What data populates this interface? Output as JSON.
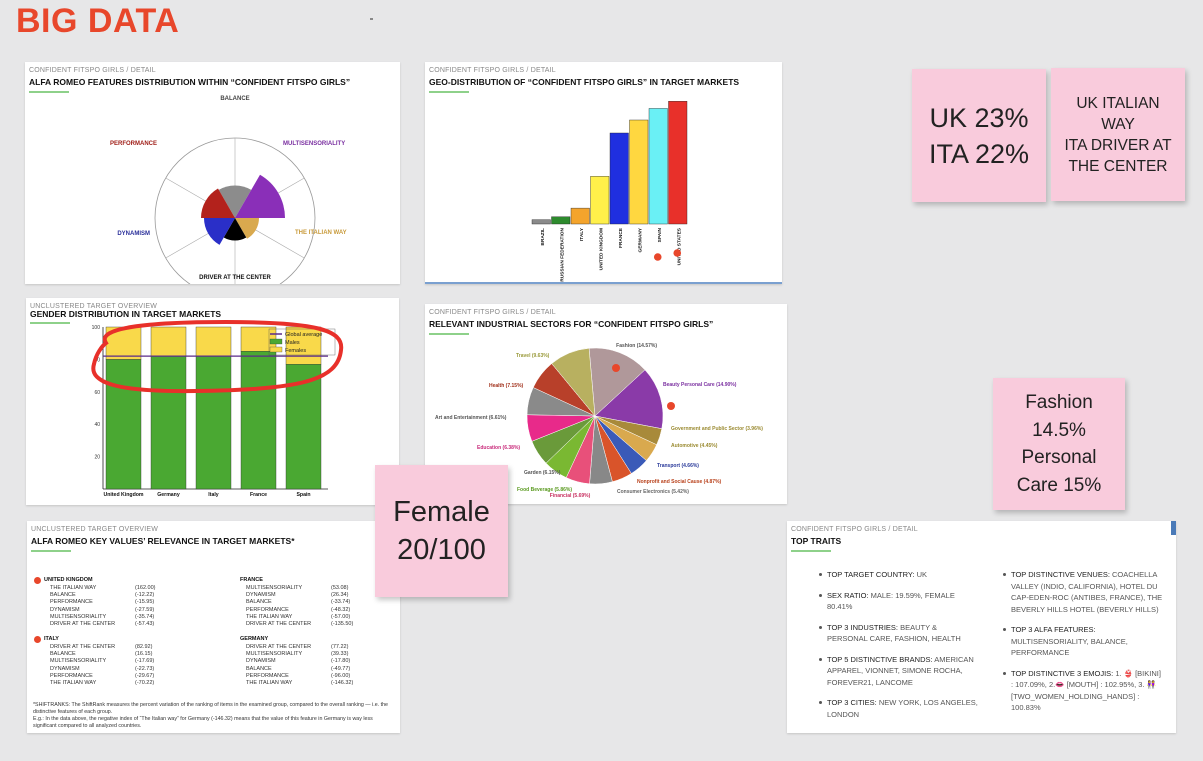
{
  "board": {
    "title": "BIG DATA"
  },
  "features": {
    "subtitle": "CONFIDENT FITSPO GIRLS / DETAIL",
    "title": "ALFA ROMEO FEATURES DISTRIBUTION WITHIN “CONFIDENT FITSPO GIRLS”",
    "labels": [
      "BALANCE",
      "MULTISENSORIALITY",
      "THE ITALIAN WAY",
      "DRIVER AT THE CENTER",
      "DYNAMISM",
      "PERFORMANCE"
    ],
    "colors": [
      "#8c8c8c",
      "#8a2fb8",
      "#d9a94e",
      "#000000",
      "#2a2fc8",
      "#b3221c"
    ],
    "label_colors": [
      "#444444",
      "#7a2fa0",
      "#c89a3a",
      "#111111",
      "#2a2f9a",
      "#a0201a"
    ],
    "values": [
      0.65,
      1.0,
      0.48,
      0.45,
      0.62,
      0.68
    ]
  },
  "geo": {
    "subtitle": "CONFIDENT FITSPO GIRLS / DETAIL",
    "title": "GEO-DISTRIBUTION OF “CONFIDENT FITSPO GIRLS” IN TARGET MARKETS",
    "values": [
      3,
      5,
      11,
      33,
      63,
      72,
      80,
      85
    ],
    "colors": [
      "#8a8a8a",
      "#2e8b2e",
      "#f4a42c",
      "#fff04a",
      "#1f2fe0",
      "#ffd740",
      "#6af0f5",
      "#e8302a"
    ],
    "labels": [
      "BRAZIL",
      "RUSSIAN FEDERATION",
      "ITALY",
      "UNITED KINGDOM",
      "FRANCE",
      "GERMANY",
      "SPAIN",
      "UNITED STATES"
    ],
    "marked": [
      6,
      7
    ],
    "ylim": [
      0,
      90
    ]
  },
  "gender": {
    "subtitle": "UNCLUSTERED TARGET OVERVIEW",
    "title": "GENDER DISTRIBUTION IN TARGET MARKETS",
    "countries": [
      "United Kingdom",
      "Germany",
      "Italy",
      "France",
      "Spain"
    ],
    "males": [
      80,
      82,
      82,
      85,
      77
    ],
    "females": [
      20,
      18,
      18,
      15,
      23
    ],
    "global_average": 82,
    "ticks": [
      "100",
      "80",
      "60",
      "40",
      "20"
    ],
    "legend": [
      "Global average",
      "Males",
      "Females"
    ],
    "colors": {
      "males": "#4aa832",
      "females": "#f9d94a",
      "avg": "#5a2a8a",
      "annotation": "#e8302a"
    }
  },
  "sectors": {
    "subtitle": "CONFIDENT FITSPO GIRLS / DETAIL",
    "title": "RELEVANT INDUSTRIAL SECTORS FOR “CONFIDENT FITSPO GIRLS”",
    "slices": [
      {
        "label": "Fashion (14.57%)",
        "value": 14.57,
        "color": "#b0989a",
        "label_color": "#555555"
      },
      {
        "label": "Beauty Personal Care (14.90%)",
        "value": 14.9,
        "color": "#8a3aa8",
        "label_color": "#7a2fa0"
      },
      {
        "label": "Government and Public Sector (3.96%)",
        "value": 3.96,
        "color": "#a88a3a",
        "label_color": "#9a8a30"
      },
      {
        "label": "Automotive (4.45%)",
        "value": 4.45,
        "color": "#d9a94e",
        "label_color": "#9a8a30"
      },
      {
        "label": "Transport (4.66%)",
        "value": 4.66,
        "color": "#3a5ab8",
        "label_color": "#2a3a9a"
      },
      {
        "label": "Nonprofit and Social Cause (4.87%)",
        "value": 4.87,
        "color": "#d9542a",
        "label_color": "#b8401a"
      },
      {
        "label": "Consumer Electronics (5.42%)",
        "value": 5.42,
        "color": "#888888",
        "label_color": "#666666"
      },
      {
        "label": "Financial (5.69%)",
        "value": 5.69,
        "color": "#e8507a",
        "label_color": "#c83060"
      },
      {
        "label": "Food Beverage (5.86%)",
        "value": 5.86,
        "color": "#7ab832",
        "label_color": "#5a9a20"
      },
      {
        "label": "Garden (6.15%)",
        "value": 6.15,
        "color": "#6a9a3a",
        "label_color": "#555555"
      },
      {
        "label": "Education (6.38%)",
        "value": 6.38,
        "color": "#e82a8a",
        "label_color": "#c82a7a"
      },
      {
        "label": "Art and Entertainment (6.61%)",
        "value": 6.61,
        "color": "#8a8a8a",
        "label_color": "#555555"
      },
      {
        "label": "Health (7.15%)",
        "value": 7.15,
        "color": "#b8402a",
        "label_color": "#a0301a"
      },
      {
        "label": "Travel (9.63%)",
        "value": 9.63,
        "color": "#b8b060",
        "label_color": "#9a9a3a"
      }
    ],
    "marked": [
      0,
      1
    ]
  },
  "keyvalues": {
    "subtitle": "UNCLUSTERED TARGET OVERVIEW",
    "title": "ALFA ROMEO KEY VALUES’ RELEVANCE IN TARGET MARKETS*",
    "groups": [
      {
        "country": "UNITED KINGDOM",
        "marked": true,
        "rows": [
          [
            "THE ITALIAN WAY",
            "(162.00)"
          ],
          [
            "BALANCE",
            "(-12.22)"
          ],
          [
            "PERFORMANCE",
            "(-15.95)"
          ],
          [
            "DYNAMISM",
            "(-27.59)"
          ],
          [
            "MULTISENSORIALITY",
            "(-35.74)"
          ],
          [
            "DRIVER AT THE CENTER",
            "(-57.43)"
          ]
        ]
      },
      {
        "country": "FRANCE",
        "marked": false,
        "rows": [
          [
            "MULTISENSORIALITY",
            "(53.08)"
          ],
          [
            "DYNAMISM",
            "(26.34)"
          ],
          [
            "BALANCE",
            "(-33.74)"
          ],
          [
            "PERFORMANCE",
            "(-48.32)"
          ],
          [
            "THE ITALIAN WAY",
            "(-57.00)"
          ],
          [
            "DRIVER AT THE CENTER",
            "(-135.50)"
          ]
        ]
      },
      {
        "country": "ITALY",
        "marked": true,
        "rows": [
          [
            "DRIVER AT THE CENTER",
            "(82.92)"
          ],
          [
            "BALANCE",
            "(16.15)"
          ],
          [
            "MULTISENSORIALITY",
            "(-17.69)"
          ],
          [
            "DYNAMISM",
            "(-22.73)"
          ],
          [
            "PERFORMANCE",
            "(-29.67)"
          ],
          [
            "THE ITALIAN WAY",
            "(-70.22)"
          ]
        ]
      },
      {
        "country": "GERMANY",
        "marked": false,
        "rows": [
          [
            "DRIVER AT THE CENTER",
            "(77.22)"
          ],
          [
            "MULTISENSORIALITY",
            "(39.33)"
          ],
          [
            "DYNAMISM",
            "(-17.80)"
          ],
          [
            "BALANCE",
            "(-49.77)"
          ],
          [
            "PERFORMANCE",
            "(-96.00)"
          ],
          [
            "THE ITALIAN WAY",
            "(-146.32)"
          ]
        ]
      }
    ],
    "footnote_1": "*SHIFTRANKS: The ShiftRank measures the percent variation of the ranking of items in the examined group, compared to the overall ranking — i.e. the distinctive features of each group.",
    "footnote_2": "E.g.: In the data above, the negative index of “The Italian way” for Germany (-146.32) means that the value of this feature in Germany is way less significant compared to all analyzed countries."
  },
  "traits": {
    "subtitle": "CONFIDENT FITSPO GIRLS / DETAIL",
    "title": "TOP TRAITS",
    "left": [
      {
        "k": "TOP TARGET COUNTRY:",
        "v": " UK"
      },
      {
        "k": "SEX RATIO:",
        "v": " MALE: 19.59%, FEMALE 80.41%"
      },
      {
        "k": "TOP 3 INDUSTRIES:",
        "v": " BEAUTY & PERSONAL CARE, FASHION, HEALTH"
      },
      {
        "k": "TOP 5 DISTINCTIVE BRANDS:",
        "v": " AMERICAN APPAREL, VIONNET, SIMONE ROCHA, FOREVER21, LANCOME"
      },
      {
        "k": "TOP 3 CITIES:",
        "v": " NEW YORK, LOS ANGELES, LONDON"
      }
    ],
    "right": [
      {
        "k": "TOP DISTINCTIVE VENUES:",
        "v": " COACHELLA VALLEY (INDIO, CALIFORNIA), HOTEL DU CAP-EDEN-ROC (ANTIBES, FRANCE), THE BEVERLY HILLS HOTEL (BEVERLY HILLS)"
      },
      {
        "k": "TOP 3 ALFA FEATURES:",
        "v": " MULTISENSORIALITY, BALANCE, PERFORMANCE"
      },
      {
        "k": "TOP DISTINCTIVE 3 EMOJIS:",
        "v": " 1. 👙 [BIKINI] : 107.09%,  2.👄 [MOUTH] : 102.95%, 3. 👭 [TWO_WOMEN_HOLDING_HANDS] : 100.83%"
      }
    ]
  },
  "stickies": {
    "uk_ita": [
      "UK 23%",
      "ITA 22%"
    ],
    "italian_way": [
      "UK ITALIAN",
      "WAY",
      "ITA DRIVER AT",
      "THE CENTER"
    ],
    "fashion": [
      "Fashion",
      "14.5%",
      "Personal",
      "Care 15%"
    ],
    "female": [
      "Female",
      "20/100"
    ]
  }
}
